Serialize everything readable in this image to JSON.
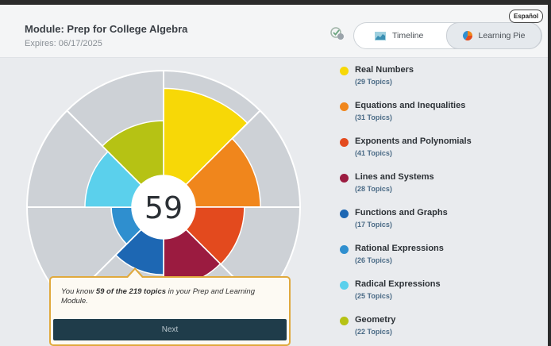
{
  "header": {
    "title": "Module: Prep for College Algebra",
    "expires": "Expires: 06/17/2025",
    "language_button": "Español"
  },
  "view_toggle": {
    "timeline_label": "Timeline",
    "pie_label": "Learning Pie",
    "selected": "Learning Pie"
  },
  "pie": {
    "center_value": "59",
    "total_topics": 219,
    "known_topics": 59
  },
  "legend": [
    {
      "name": "Real Numbers",
      "count": "(29 Topics)",
      "color": "#f7d807",
      "known": 20
    },
    {
      "name": "Equations and Inequalities",
      "count": "(31 Topics)",
      "color": "#f0861c",
      "known": 12
    },
    {
      "name": "Exponents and Polynomials",
      "count": "(41 Topics)",
      "color": "#e34a1e",
      "known": 9
    },
    {
      "name": "Lines and Systems",
      "count": "(28 Topics)",
      "color": "#9b1b40",
      "known": 6
    },
    {
      "name": "Functions and Graphs",
      "count": "(17 Topics)",
      "color": "#1d67b3",
      "known": 2
    },
    {
      "name": "Rational Expressions",
      "count": "(26 Topics)",
      "color": "#2f8fcf",
      "known": 1
    },
    {
      "name": "Radical Expressions",
      "count": "(25 Topics)",
      "color": "#5bd0ec",
      "known": 5
    },
    {
      "name": "Geometry",
      "count": "(22 Topics)",
      "color": "#b6c214",
      "known": 6
    }
  ],
  "tooltip": {
    "prefix": "You know ",
    "bold": "59 of the 219 topics",
    "suffix": " in your Prep and Learning Module.",
    "button": "Next"
  }
}
